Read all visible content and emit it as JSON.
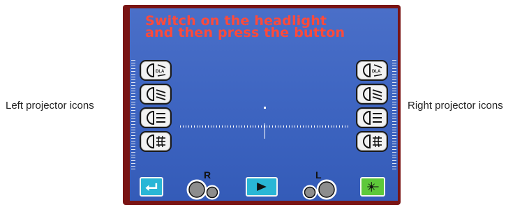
{
  "screen": {
    "prompt_lines": [
      "Switch on the headlight",
      "and then press the button"
    ]
  },
  "captions": {
    "left": "Left projector icons",
    "right": "Right projector icons"
  },
  "projector_icons": [
    {
      "name": "dla-icon",
      "label": "DLA"
    },
    {
      "name": "low-beam-icon"
    },
    {
      "name": "high-beam-icon"
    },
    {
      "name": "fog-lamp-icon"
    }
  ],
  "bottom_bar": {
    "right_wheel_label": "R",
    "left_wheel_label": "L"
  },
  "colors": {
    "screen_bg": "#3f66c2",
    "prompt_text": "#ff4a3a",
    "button_cyan": "#29b6d6",
    "button_green": "#5dc83a"
  }
}
